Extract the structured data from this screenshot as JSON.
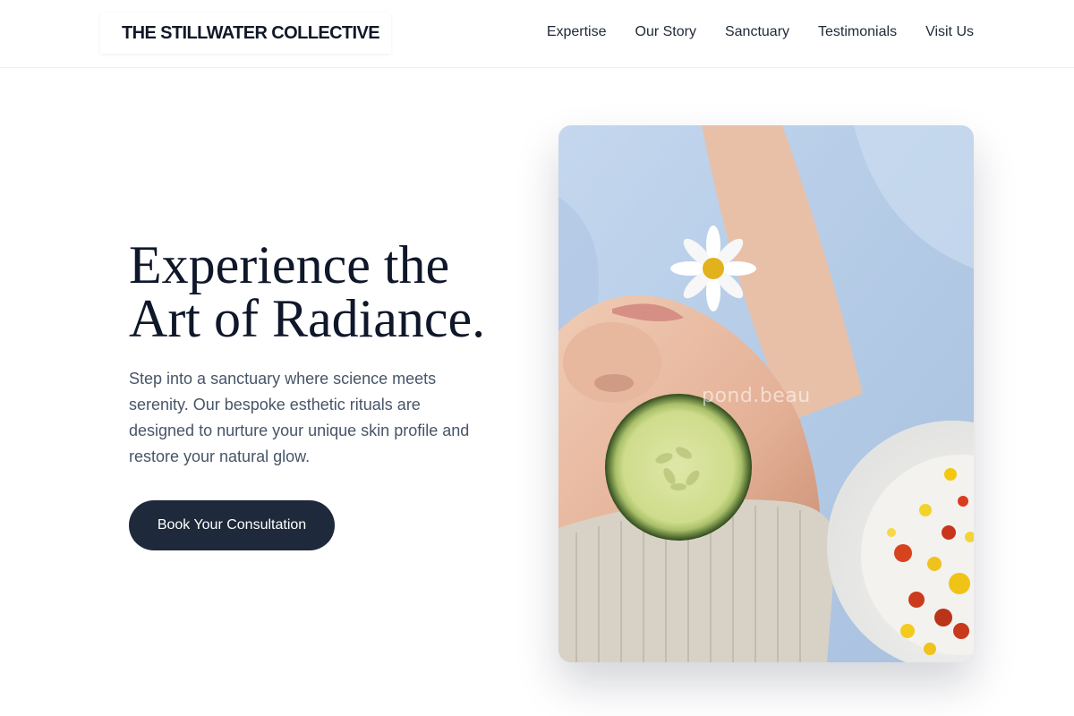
{
  "header": {
    "logo": "THE STILLWATER COLLECTIVE",
    "nav": [
      {
        "label": "Expertise"
      },
      {
        "label": "Our Story"
      },
      {
        "label": "Sanctuary"
      },
      {
        "label": "Testimonials"
      },
      {
        "label": "Visit Us"
      }
    ]
  },
  "hero": {
    "title_line1": "Experience the",
    "title_line2": "Art of Radiance.",
    "description": "Step into a sanctuary where science meets serenity. Our bespoke esthetic rituals are designed to nurture your unique skin profile and restore your natural glow.",
    "cta_label": "Book Your Consultation",
    "image": {
      "subject": "spa-facial-photo",
      "watermark": "pond.beau"
    }
  },
  "colors": {
    "primary": "#1e293b",
    "heading": "#0f172a",
    "body_text": "#475569",
    "towel_blue": "#bcd3ea"
  }
}
